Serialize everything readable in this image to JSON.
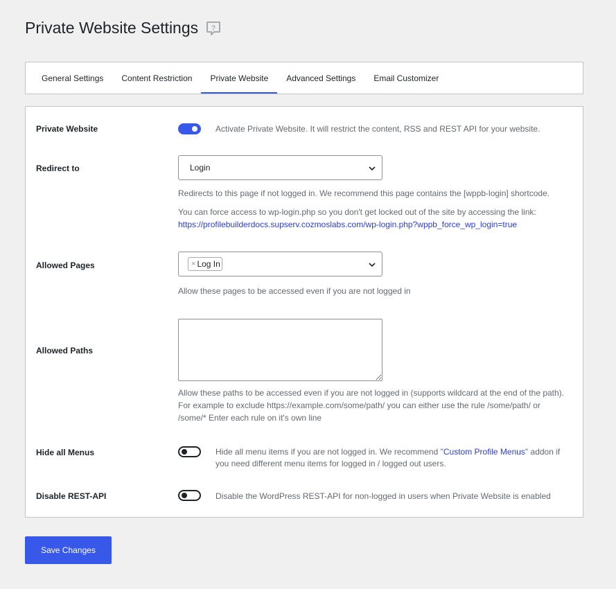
{
  "page": {
    "title": "Private Website Settings"
  },
  "tabs": [
    {
      "label": "General Settings"
    },
    {
      "label": "Content Restriction"
    },
    {
      "label": "Private Website"
    },
    {
      "label": "Advanced Settings"
    },
    {
      "label": "Email Customizer"
    }
  ],
  "active_tab": "Private Website",
  "settings": {
    "private_website": {
      "label": "Private Website",
      "enabled": true,
      "description": "Activate Private Website. It will restrict the content, RSS and REST API for your website."
    },
    "redirect_to": {
      "label": "Redirect to",
      "selected": "Login",
      "description": "Redirects to this page if not logged in. We recommend this page contains the [wppb-login] shortcode.",
      "note": "You can force access to wp-login.php so you don't get locked out of the site by accessing the link:",
      "link": "https://profilebuilderdocs.supserv.cozmoslabs.com/wp-login.php?wppb_force_wp_login=true"
    },
    "allowed_pages": {
      "label": "Allowed Pages",
      "tags": [
        "Log In"
      ],
      "tag_remove": "×",
      "description": "Allow these pages to be accessed even if you are not logged in"
    },
    "allowed_paths": {
      "label": "Allowed Paths",
      "value": "",
      "description_line1": "Allow these paths to be accessed even if you are not logged in (supports wildcard at the end of the path).",
      "description_line2": "For example to exclude https://example.com/some/path/ you can either use the rule /some/path/ or",
      "description_line3": "/some/* Enter each rule on it's own line"
    },
    "hide_menus": {
      "label": "Hide all Menus",
      "enabled": false,
      "description_pre": "Hide all menu items if you are not logged in. We recommend \"",
      "description_link": "Custom Profile Menus",
      "description_post": "\" addon if",
      "description_line2": "you need different menu items for logged in / logged out users."
    },
    "disable_rest": {
      "label": "Disable REST-API",
      "enabled": false,
      "description": "Disable the WordPress REST-API for non-logged in users when Private Website is enabled"
    }
  },
  "actions": {
    "save_label": "Save Changes"
  },
  "colors": {
    "accent": "#3858e9",
    "link": "#2c3dd8",
    "background": "#f0f0f1"
  }
}
